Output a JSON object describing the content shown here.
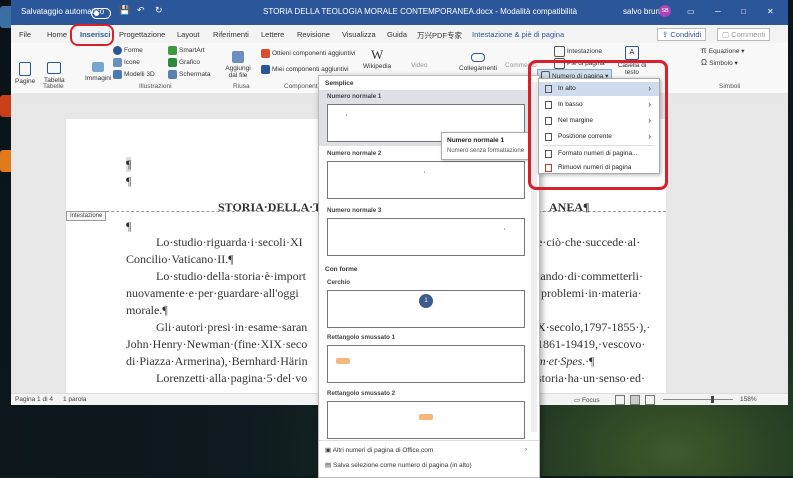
{
  "window": {
    "autosave_label": "Salvataggio automatico",
    "doc_title": "STORIA DELLA TEOLOGIA MORALE CONTEMPORANEA.docx  -  Modalità compatibilità",
    "user_name": "salvo bruno",
    "user_initials": "SB",
    "minimize": "─",
    "maximize": "□",
    "close": "✕"
  },
  "tabs": [
    "File",
    "Home",
    "Inserisci",
    "Progettazione",
    "Layout",
    "Riferimenti",
    "Lettere",
    "Revisione",
    "Visualizza",
    "Guida",
    "万兴PDF专家",
    "Intestazione & piè di pagina"
  ],
  "share_label": "Condividi",
  "comments_label": "Commenti",
  "ribbon": {
    "pages": "Pagine",
    "table": "Tabella",
    "images": "Immagini",
    "shapes": "Forme",
    "icons": "Icone",
    "models3d": "Modelli 3D",
    "smartart": "SmartArt",
    "chart": "Grafico",
    "screenshot": "Schermata",
    "addin": "Aggiungi dal file",
    "get_addins": "Ottieni componenti aggiuntivi",
    "my_addins": "Miei componenti aggiuntivi",
    "wikipedia": "Wikipedia",
    "video": "Video",
    "links": "Collegamenti",
    "comment": "Commento",
    "header": "Intestazione",
    "footer": "Piè di pagina",
    "page_number": "Numero di pagina",
    "textbox": "Casella di testo",
    "equation": "Equazione",
    "symbol": "Simbolo",
    "groups": {
      "tables": "Tabelle",
      "illustrations": "Illustrazioni",
      "reuse": "Riusa",
      "components": "Componenti",
      "symbols": "Simboli"
    }
  },
  "document": {
    "mark1": "¶",
    "mark2": "¶",
    "header_label": "Intestazione",
    "title_left": "STORIA·DELLA·TE",
    "title_right": "ANEA¶",
    "pil": "¶",
    "line1_left": "Lo·studio·riguarda·i·secoli·XI",
    "line1_right": "e·ciò·che·succede·al·",
    "line2": "Concilio·Vaticano·II.¶",
    "line3_left": "Lo·studio·della·storia·è·import",
    "line3_right": "tando·di·commetterli·",
    "line4_left": "nuovamente·e·per·guardare·all'oggi",
    "line4_right": "·problemi·in·materia·",
    "line5": "morale.¶",
    "line6_left": "Gli·autori·presi·in·esame·saran",
    "line6_right": "X·secolo,1797-1855·),·",
    "line7_left": "John·Henry·Newman·(fine·XIX·seco",
    "line7_right": "1861-19419,·vescovo·",
    "line8_left": "di·Piazza·Armerina),·Bernhard·Härin",
    "line8_right": "m·et·Spes.·¶",
    "line9_left": "Lorenzetti·alla·pagina·5·del·vo",
    "line9_right": "storia·ha·un·senso·ed·"
  },
  "status": {
    "page": "Pagina 1 di 4",
    "words": "1 parola",
    "focus": "Focus",
    "zoom": "158%"
  },
  "gallery": {
    "section_simple": "Semplice",
    "items_simple": [
      "Numero normale 1",
      "Numero normale 2",
      "Numero normale 3"
    ],
    "section_shapes": "Con forme",
    "items_shapes": [
      "Cerchio",
      "Rettangolo smussato 1",
      "Rettangolo smussato 2"
    ],
    "circle_number": "1",
    "more_link": "Altri numeri di pagina di Office.com",
    "save_link": "Salva selezione come numero di pagina (in alto)"
  },
  "tooltip": {
    "title": "Numero normale 1",
    "desc": "Numero senza formattazione"
  },
  "dropdown": {
    "button_label": "Numero di pagina",
    "items": [
      "In alto",
      "In basso",
      "Nel margine",
      "Posizione corrente",
      "Formato numeri di pagina...",
      "Rimuovi numeri di pagina"
    ]
  },
  "colors": {
    "word_blue": "#2b579a",
    "highlight_red": "#d9202a",
    "rounded_rect": "#f3b87a",
    "circle": "#3b5c8c"
  }
}
